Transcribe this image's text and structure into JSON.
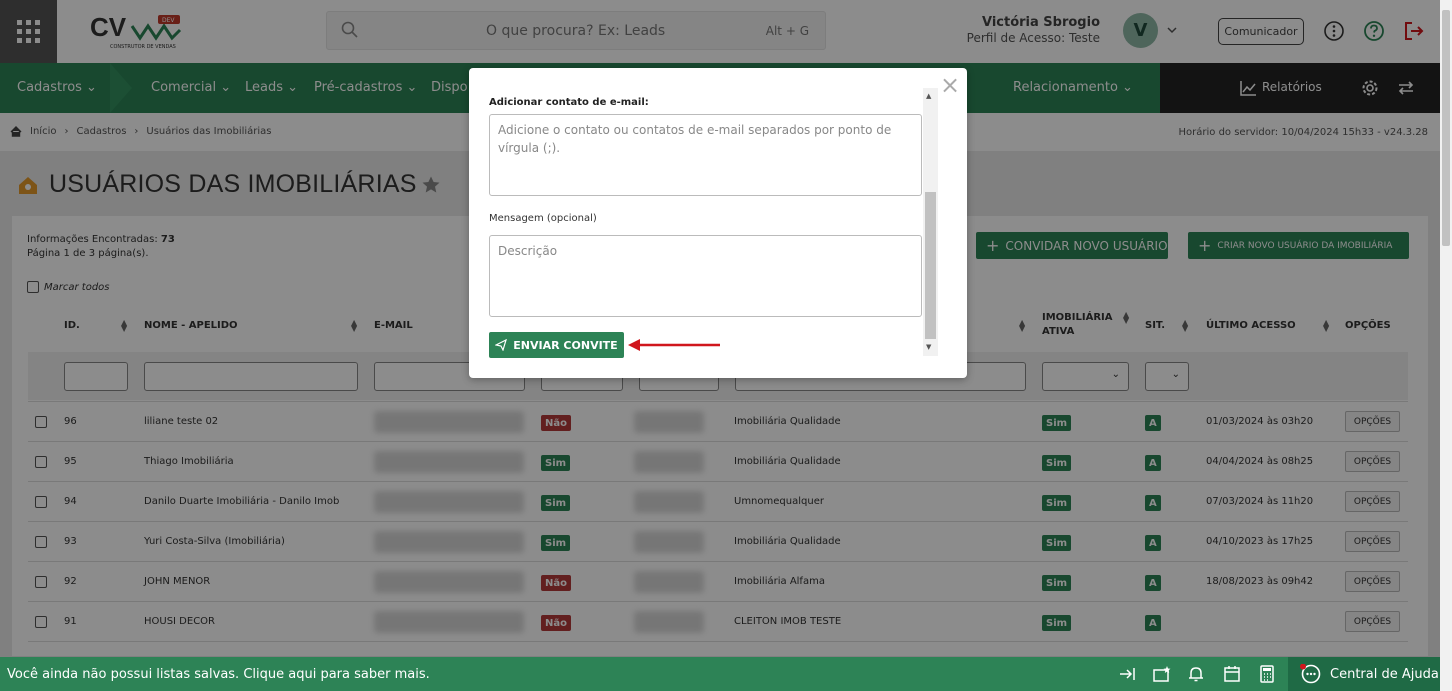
{
  "header": {
    "logo_text": "CV",
    "logo_tag": "DEV",
    "logo_sub": "CONSTRUTOR DE VENDAS",
    "search_placeholder": "O que procura? Ex: Leads",
    "search_shortcut": "Alt + G",
    "user_name": "Victória Sbrogio",
    "user_profile": "Perfil de Acesso: Teste",
    "avatar_letter": "V",
    "communicator_label": "Comunicador"
  },
  "nav": {
    "items": [
      "Cadastros",
      "Comercial",
      "Leads",
      "Pré-cadastros",
      "Dispo",
      "Relacionamento"
    ],
    "reports_label": "Relatórios"
  },
  "breadcrumb": {
    "items": [
      "Início",
      "Cadastros",
      "Usuários das Imobiliárias"
    ],
    "server_time": "Horário do servidor: 10/04/2024 15h33 - v24.3.28"
  },
  "page": {
    "title": "USUÁRIOS DAS IMOBILIÁRIAS",
    "info_found_label": "Informações Encontradas:",
    "info_found_count": "73",
    "info_page": "Página 1 de 3 página(s).",
    "mark_all": "Marcar todos",
    "invite_button": "CONVIDAR NOVO USUÁRIO",
    "create_button": "CRIAR NOVO USUÁRIO DA IMOBILIÁRIA"
  },
  "table": {
    "headers": {
      "id": "ID.",
      "name": "NOME - APELIDO",
      "email": "E-MAIL",
      "imob_ativa_1": "IMOBILIÁRIA",
      "imob_ativa_2": "ATIVA",
      "sit": "SIT.",
      "last_access": "ÚLTIMO ACESSO",
      "options": "OPÇÕES"
    },
    "rows": [
      {
        "id": "96",
        "name": "liliane teste 02",
        "flag": "Não",
        "imobiliaria": "Imobiliária Qualidade",
        "ativa": "Sim",
        "sit": "A",
        "last": "01/03/2024 às 03h20",
        "opt": "OPÇÕES"
      },
      {
        "id": "95",
        "name": "Thiago Imobiliária",
        "flag": "Sim",
        "imobiliaria": "Imobiliária Qualidade",
        "ativa": "Sim",
        "sit": "A",
        "last": "04/04/2024 às 08h25",
        "opt": "OPÇÕES"
      },
      {
        "id": "94",
        "name": "Danilo Duarte Imobiliária - Danilo Imob",
        "flag": "Sim",
        "imobiliaria": "Umnomequalquer",
        "ativa": "Sim",
        "sit": "A",
        "last": "07/03/2024 às 11h20",
        "opt": "OPÇÕES"
      },
      {
        "id": "93",
        "name": "Yuri Costa-Silva (Imobiliária)",
        "flag": "Sim",
        "imobiliaria": "Imobiliária Qualidade",
        "ativa": "Sim",
        "sit": "A",
        "last": "04/10/2023 às 17h25",
        "opt": "OPÇÕES"
      },
      {
        "id": "92",
        "name": "JOHN MENOR",
        "flag": "Não",
        "imobiliaria": "Imobiliária Alfama",
        "ativa": "Sim",
        "sit": "A",
        "last": "18/08/2023 às 09h42",
        "opt": "OPÇÕES"
      },
      {
        "id": "91",
        "name": "HOUSI DECOR",
        "flag": "Não",
        "imobiliaria": "CLEITON IMOB TESTE",
        "ativa": "Sim",
        "sit": "A",
        "last": "",
        "opt": "OPÇÕES"
      }
    ]
  },
  "modal": {
    "email_label": "Adicionar contato de e-mail:",
    "email_placeholder": "Adicione o contato ou contatos de e-mail separados por ponto de vírgula (;).",
    "message_label": "Mensagem (opcional)",
    "message_placeholder": "Descrição",
    "send_button": "ENVIAR CONVITE"
  },
  "footer": {
    "message": "Você ainda não possui listas salvas. Clique aqui para saber mais.",
    "help_label": "Central de Ajuda"
  },
  "colors": {
    "brand_green": "#2d8356",
    "danger_red": "#b33a3a",
    "arrow_red": "#d0161d"
  }
}
